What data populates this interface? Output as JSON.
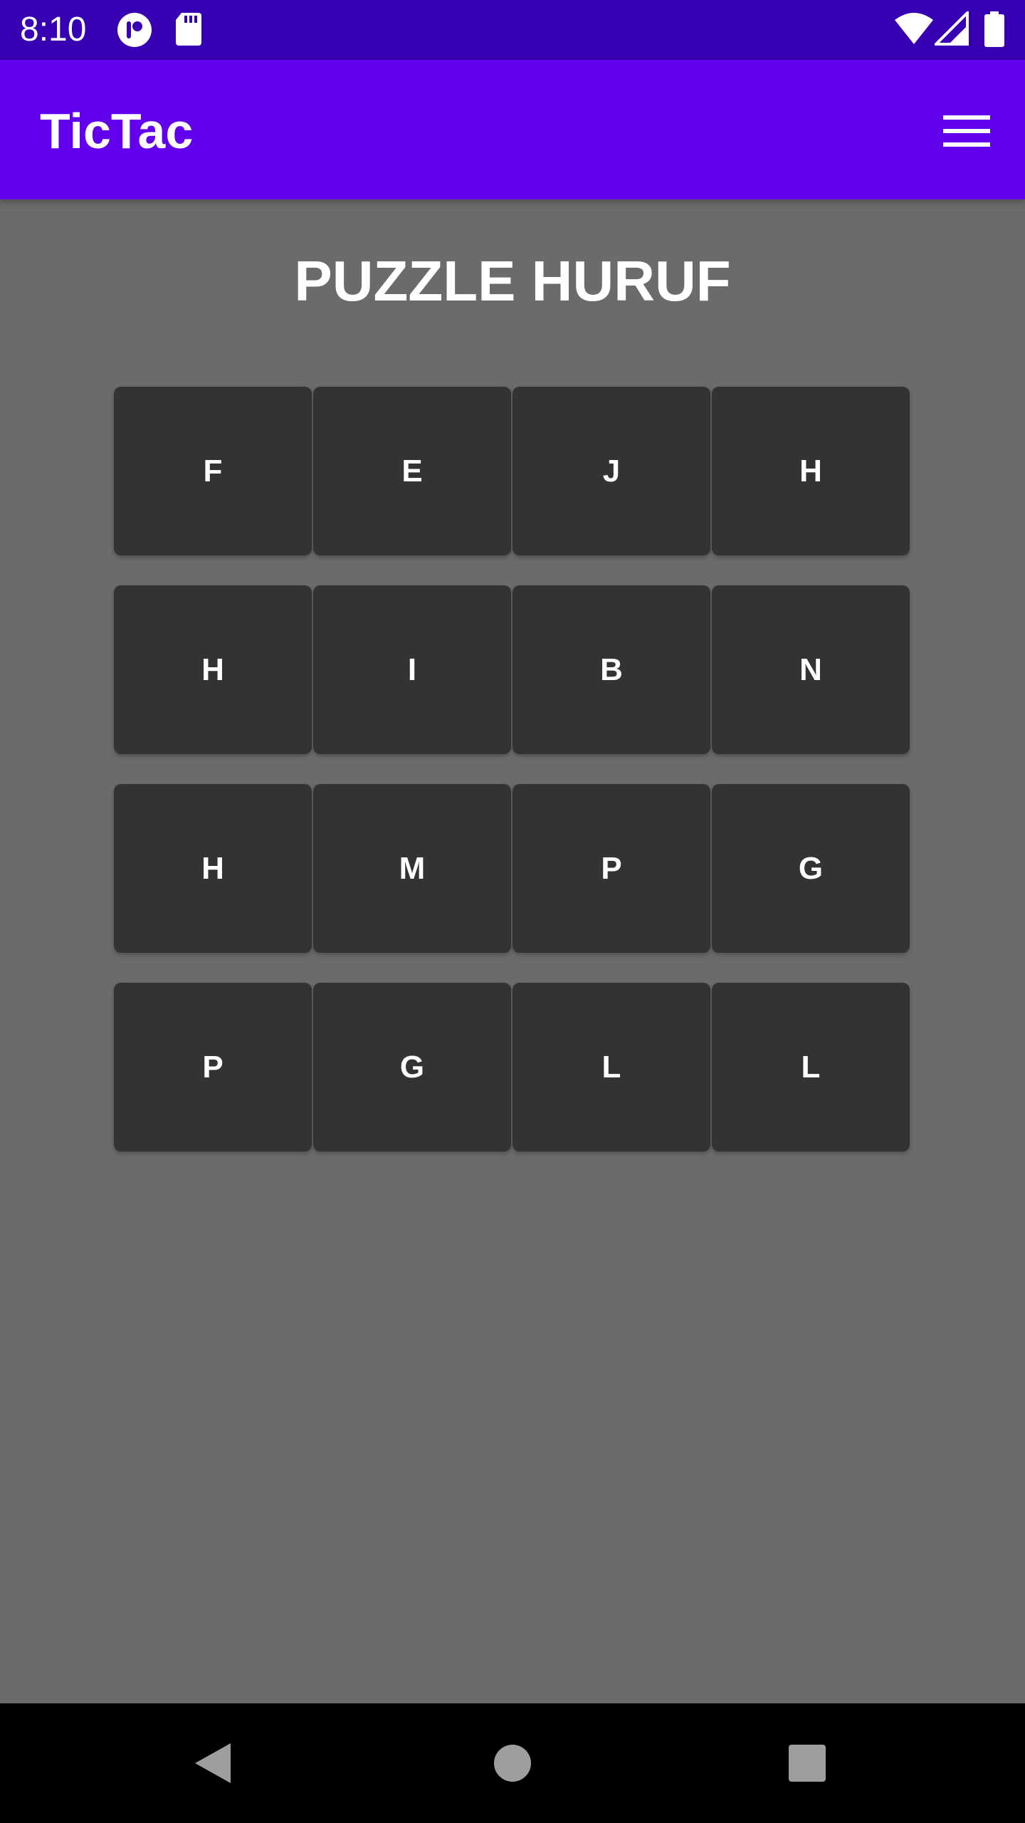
{
  "status_bar": {
    "time": "8:10",
    "icons": [
      "notification-app-icon",
      "sd-card-icon",
      "wifi-icon",
      "signal-icon",
      "battery-icon"
    ]
  },
  "app_bar": {
    "title": "TicTac",
    "menu_icon": "hamburger-menu-icon"
  },
  "main": {
    "title": "PUZZLE HURUF",
    "grid": [
      [
        "F",
        "E",
        "J",
        "H"
      ],
      [
        "H",
        "I",
        "B",
        "N"
      ],
      [
        "H",
        "M",
        "P",
        "G"
      ],
      [
        "P",
        "G",
        "L",
        "L"
      ]
    ]
  },
  "nav_bar": {
    "icons": [
      "back-icon",
      "home-icon",
      "recents-icon"
    ]
  },
  "colors": {
    "status_bar": "#3700b3",
    "app_bar": "#6200ee",
    "background": "#6b6b6b",
    "tile": "#333333"
  }
}
